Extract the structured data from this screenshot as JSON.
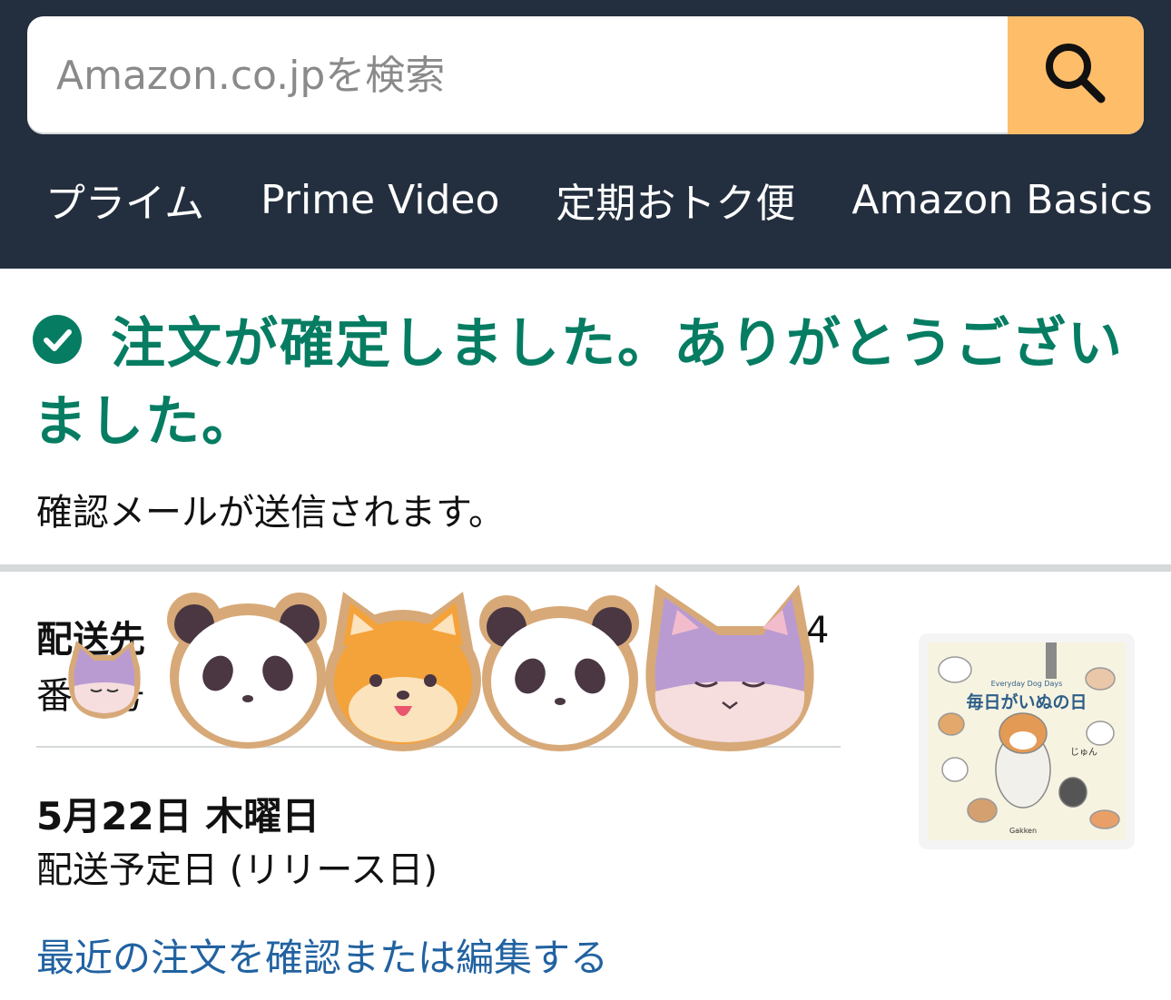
{
  "search": {
    "placeholder": "Amazon.co.jpを検索",
    "value": ""
  },
  "nav": {
    "items": [
      "プライム",
      "Prime Video",
      "定期おトク便",
      "Amazon Basics"
    ]
  },
  "confirmation": {
    "title": "注文が確定しました。ありがとうございました。",
    "subtitle": "確認メールが送信されます。"
  },
  "shipping": {
    "label": "配送先",
    "visible_tail": "4",
    "line2": "番　号"
  },
  "delivery": {
    "date": "5月22日 木曜日",
    "note": "配送予定日 (リリース日)"
  },
  "links": {
    "orders": "最近の注文を確認または編集する"
  },
  "product": {
    "title": "毎日がいぬの日",
    "subtitle_en": "Everyday Dog Days",
    "author": "じゅん",
    "publisher": "Gakken"
  },
  "colors": {
    "header_bg": "#232f3e",
    "search_button": "#febd69",
    "success_green": "#067d62",
    "link_blue": "#2162a1"
  },
  "icons": [
    "search-icon",
    "check-circle-icon"
  ]
}
